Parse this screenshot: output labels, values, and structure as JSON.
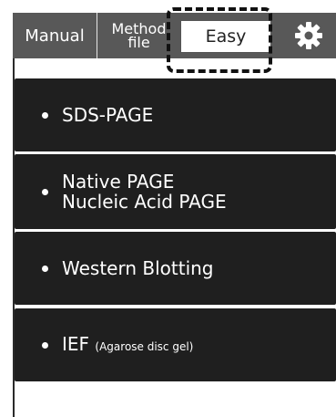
{
  "tabs": {
    "manual": "Manual",
    "method_line1": "Method",
    "method_line2": "file",
    "easy": "Easy",
    "settings_icon": "gear-icon"
  },
  "items": [
    {
      "line1": "SDS-PAGE",
      "line2": "",
      "sub": ""
    },
    {
      "line1": "Native PAGE",
      "line2": "Nucleic Acid PAGE",
      "sub": ""
    },
    {
      "line1": "Western Blotting",
      "line2": "",
      "sub": ""
    },
    {
      "line1": "IEF",
      "line2": "",
      "sub": "(Agarose disc gel)"
    }
  ],
  "colors": {
    "tab_bar": "#585858",
    "list_bg": "#1f1f1f",
    "selected_tab": "#ffffff"
  }
}
